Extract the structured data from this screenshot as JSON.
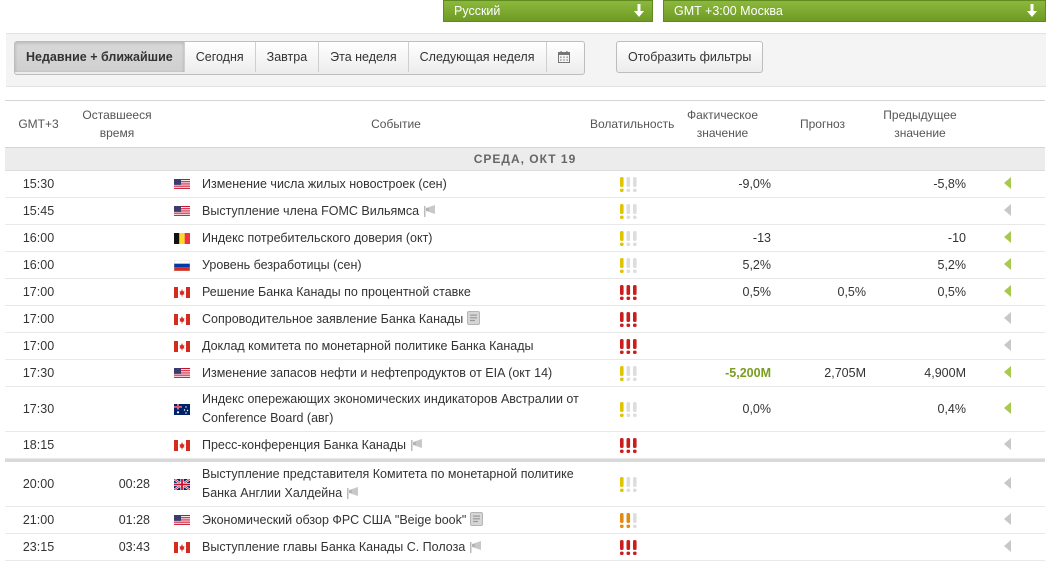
{
  "selectors": {
    "language": "Русский",
    "timezone": "GMT +3:00 Москва"
  },
  "tabs": [
    {
      "label": "Недавние + ближайшие",
      "active": true
    },
    {
      "label": "Сегодня",
      "active": false
    },
    {
      "label": "Завтра",
      "active": false
    },
    {
      "label": "Эта неделя",
      "active": false
    },
    {
      "label": "Следующая неделя",
      "active": false
    }
  ],
  "filter_button": "Отобразить фильтры",
  "columns": {
    "time": "GMT+3",
    "remaining": "Оставшееся время",
    "event": "Событие",
    "volatility": "Волатильность",
    "actual": "Фактическое значение",
    "forecast": "Прогноз",
    "previous": "Предыдущее значение"
  },
  "day_header": "СРЕДА, ОКТ 19",
  "icon_names": {
    "dropdown_arrow": "arrow-down-icon",
    "calendar": "calendar-icon",
    "speech": "megaphone-icon",
    "report": "document-icon",
    "expand": "expand-arrow-icon"
  },
  "volatility_colors": {
    "low": "#e0c400",
    "medium": "#e08b13",
    "high": "#c81e1e",
    "inactive": "#dddddd"
  },
  "rows_past": [
    {
      "time": "15:30",
      "remaining": "",
      "country": "us",
      "event": "Изменение числа жилых новостроек (сен)",
      "icon": "",
      "volatility": 1,
      "vol_color": "low",
      "actual": "-9,0%",
      "actual_style": "",
      "forecast": "",
      "previous": "-5,8%",
      "expandable": true,
      "tall": false
    },
    {
      "time": "15:45",
      "remaining": "",
      "country": "us",
      "event": "Выступление члена FOMC Вильямса",
      "icon": "speech",
      "volatility": 1,
      "vol_color": "low",
      "actual": "",
      "actual_style": "",
      "forecast": "",
      "previous": "",
      "expandable": false,
      "tall": false
    },
    {
      "time": "16:00",
      "remaining": "",
      "country": "be",
      "event": "Индекс потребительского доверия (окт)",
      "icon": "",
      "volatility": 1,
      "vol_color": "low",
      "actual": "-13",
      "actual_style": "",
      "forecast": "",
      "previous": "-10",
      "expandable": true,
      "tall": false
    },
    {
      "time": "16:00",
      "remaining": "",
      "country": "ru",
      "event": "Уровень безработицы (сен)",
      "icon": "",
      "volatility": 1,
      "vol_color": "low",
      "actual": "5,2%",
      "actual_style": "",
      "forecast": "",
      "previous": "5,2%",
      "expandable": true,
      "tall": false
    },
    {
      "time": "17:00",
      "remaining": "",
      "country": "ca",
      "event": "Решение Банка Канады по процентной ставке",
      "icon": "",
      "volatility": 3,
      "vol_color": "high",
      "actual": "0,5%",
      "actual_style": "",
      "forecast": "0,5%",
      "previous": "0,5%",
      "expandable": true,
      "tall": false
    },
    {
      "time": "17:00",
      "remaining": "",
      "country": "ca",
      "event": "Сопроводительное заявление Банка Канады",
      "icon": "report",
      "volatility": 3,
      "vol_color": "high",
      "actual": "",
      "actual_style": "",
      "forecast": "",
      "previous": "",
      "expandable": false,
      "tall": false
    },
    {
      "time": "17:00",
      "remaining": "",
      "country": "ca",
      "event": "Доклад комитета по монетарной политике Банка Канады",
      "icon": "",
      "volatility": 3,
      "vol_color": "high",
      "actual": "",
      "actual_style": "",
      "forecast": "",
      "previous": "",
      "expandable": false,
      "tall": false
    },
    {
      "time": "17:30",
      "remaining": "",
      "country": "us",
      "event": "Изменение запасов нефти и нефтепродуктов от EIA (окт 14)",
      "icon": "",
      "volatility": 1,
      "vol_color": "low",
      "actual": "-5,200M",
      "actual_style": "green",
      "forecast": "2,705M",
      "previous": "4,900M",
      "expandable": true,
      "tall": false
    },
    {
      "time": "17:30",
      "remaining": "",
      "country": "au",
      "event": "Индекс опережающих экономических индикаторов Австралии от Conference Board (авг)",
      "icon": "",
      "volatility": 1,
      "vol_color": "low",
      "actual": "0,0%",
      "actual_style": "",
      "forecast": "",
      "previous": "0,4%",
      "expandable": true,
      "tall": true
    },
    {
      "time": "18:15",
      "remaining": "",
      "country": "ca",
      "event": "Пресс-конференция Банка Канады",
      "icon": "speech",
      "volatility": 3,
      "vol_color": "high",
      "actual": "",
      "actual_style": "",
      "forecast": "",
      "previous": "",
      "expandable": false,
      "tall": false
    }
  ],
  "rows_upcoming": [
    {
      "time": "20:00",
      "remaining": "00:28",
      "country": "gb",
      "event": "Выступление представителя Комитета по монетарной политике Банка Англии Халдейна",
      "icon": "speech",
      "volatility": 1,
      "vol_color": "low",
      "actual": "",
      "actual_style": "",
      "forecast": "",
      "previous": "",
      "expandable": false,
      "tall": true
    },
    {
      "time": "21:00",
      "remaining": "01:28",
      "country": "us",
      "event": "Экономический обзор ФРС США \"Beige book\"",
      "icon": "report",
      "volatility": 2,
      "vol_color": "medium",
      "actual": "",
      "actual_style": "",
      "forecast": "",
      "previous": "",
      "expandable": false,
      "tall": false
    },
    {
      "time": "23:15",
      "remaining": "03:43",
      "country": "ca",
      "event": "Выступление главы Банка Канады С. Полоза",
      "icon": "speech",
      "volatility": 3,
      "vol_color": "high",
      "actual": "",
      "actual_style": "",
      "forecast": "",
      "previous": "",
      "expandable": false,
      "tall": false
    }
  ]
}
